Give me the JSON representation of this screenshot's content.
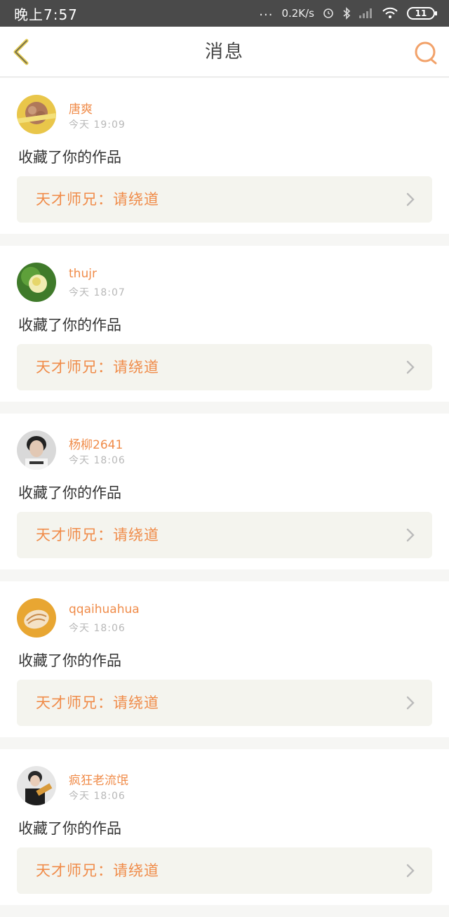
{
  "status_bar": {
    "time": "晚上7:57",
    "dots": "...",
    "net_speed": "0.2K/s",
    "battery": "11"
  },
  "header": {
    "title": "消息",
    "back_icon": "chevron-left-icon",
    "search_icon": "search-icon"
  },
  "messages": [
    {
      "username": "唐爽",
      "time": "今天 19:09",
      "action": "收藏了你的作品",
      "work_title": "天才师兄：请绕道",
      "avatar": "yellow-flower"
    },
    {
      "username": "thujr",
      "time": "今天 18:07",
      "action": "收藏了你的作品",
      "work_title": "天才师兄：请绕道",
      "avatar": "green-flower"
    },
    {
      "username": "杨柳2641",
      "time": "今天 18:06",
      "action": "收藏了你的作品",
      "work_title": "天才师兄：请绕道",
      "avatar": "boy-portrait"
    },
    {
      "username": "qqaihuahua",
      "time": "今天 18:06",
      "action": "收藏了你的作品",
      "work_title": "天才师兄：请绕道",
      "avatar": "shell"
    },
    {
      "username": "疯狂老流氓",
      "time": "今天 18:06",
      "action": "收藏了你的作品",
      "work_title": "天才师兄：请绕道",
      "avatar": "guitar-man"
    }
  ],
  "colors": {
    "accent": "#f08c4a",
    "status_bar": "#4a4a4a",
    "work_box": "#f4f4ee"
  }
}
